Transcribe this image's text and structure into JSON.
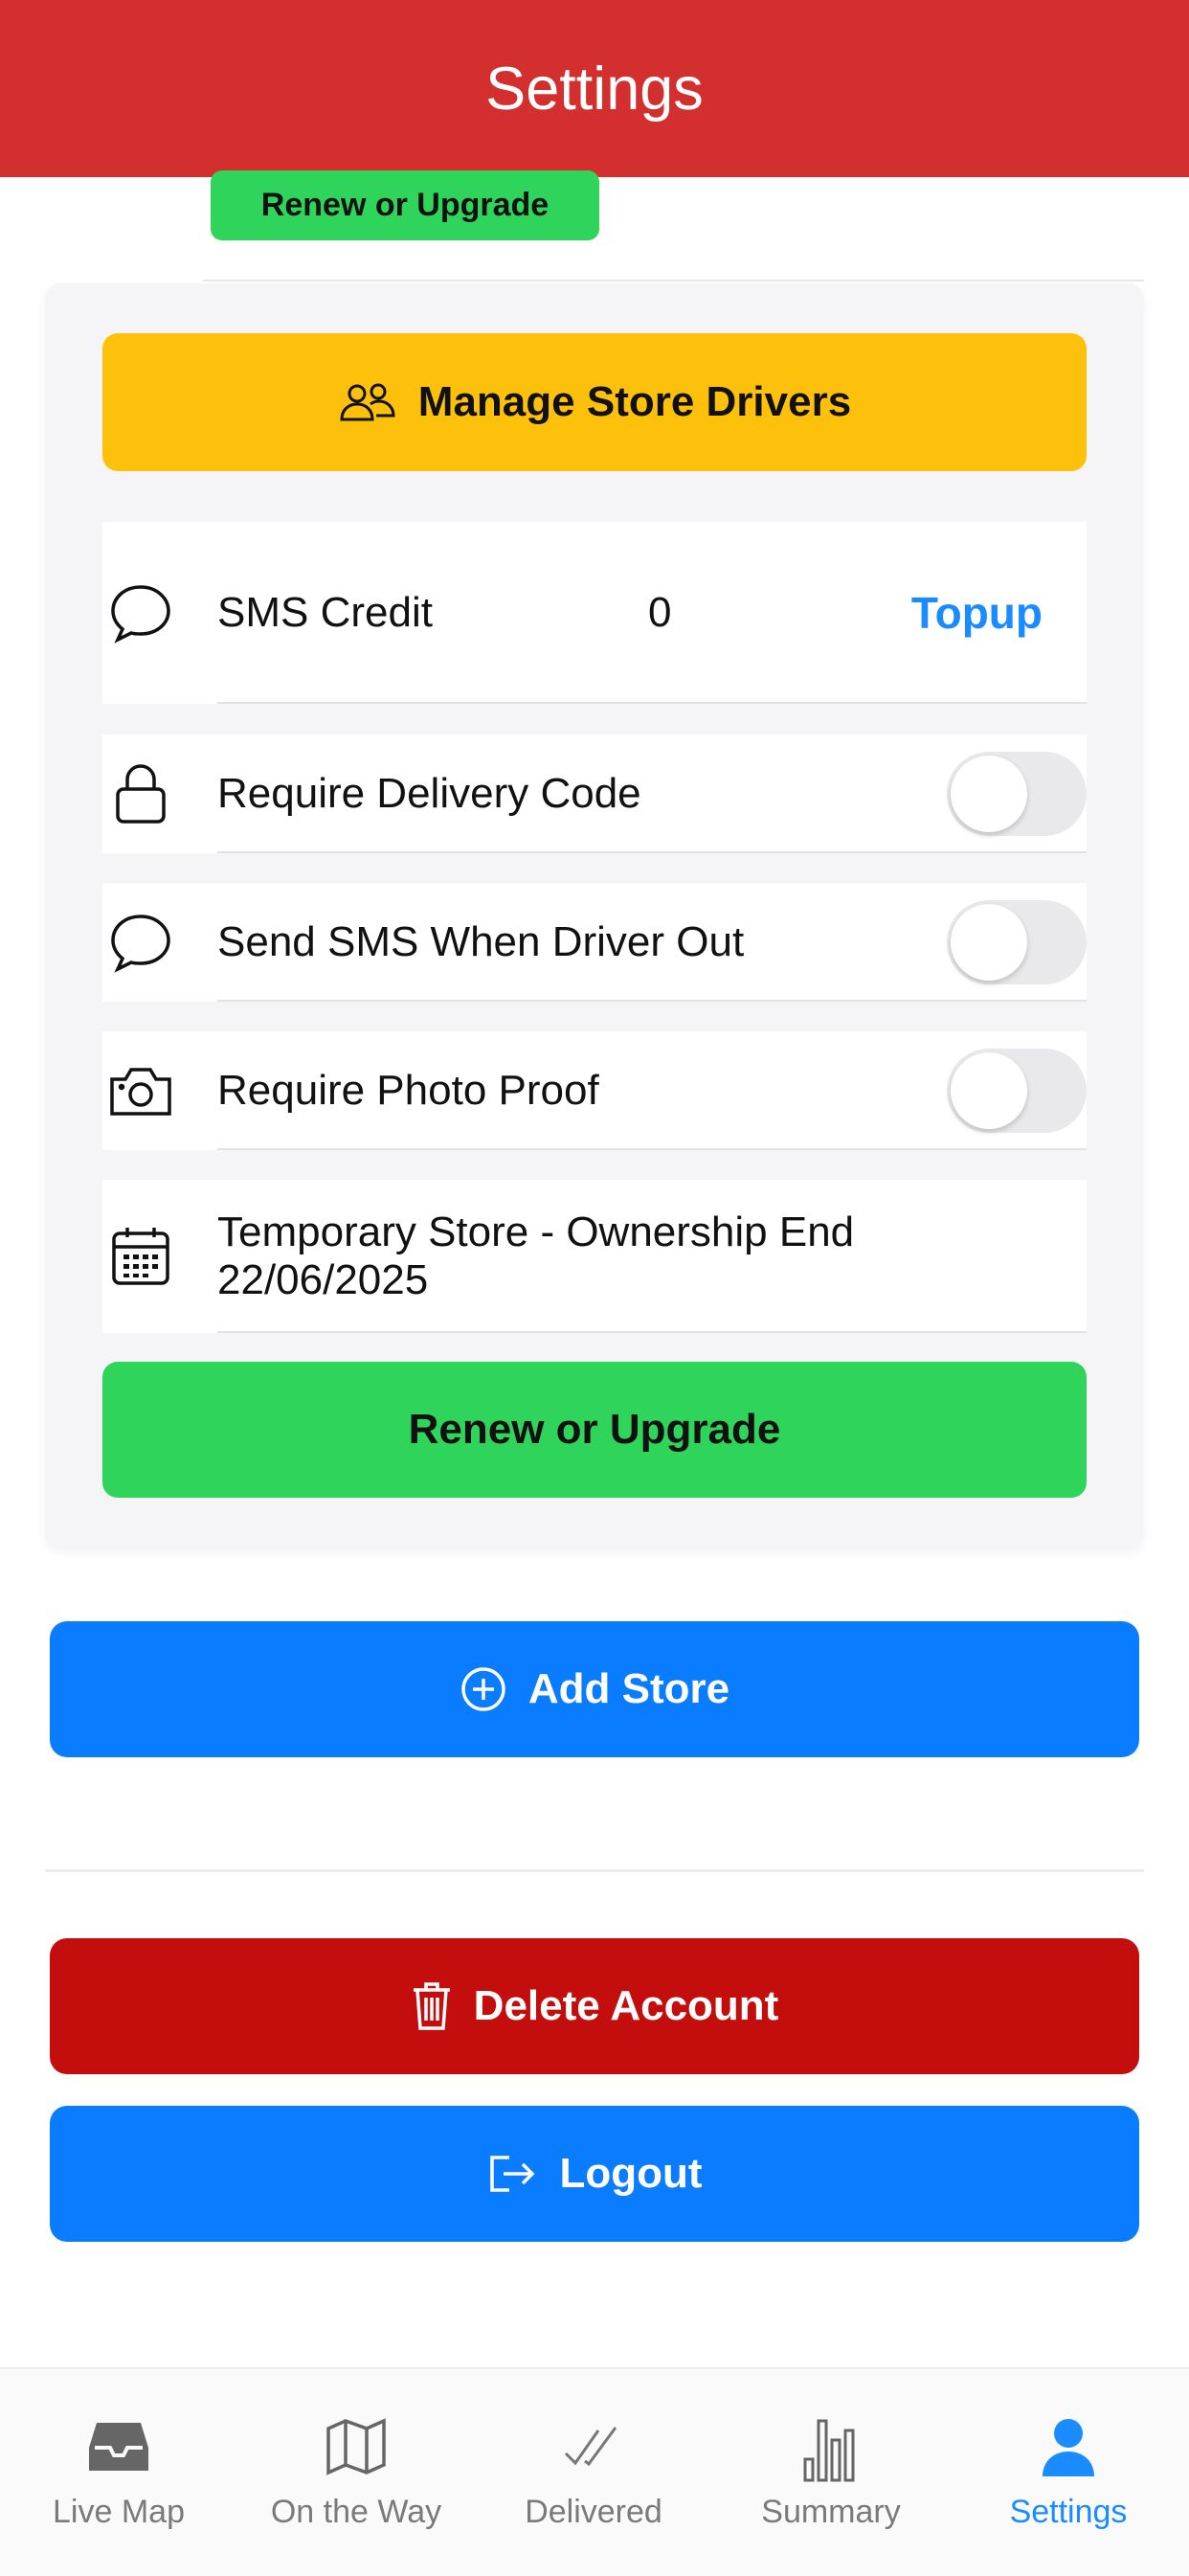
{
  "header": {
    "title": "Settings"
  },
  "store_card": {
    "renew_small_label": "Renew or Upgrade",
    "manage_drivers_label": "Manage Store Drivers",
    "sms_credit": {
      "label": "SMS Credit",
      "value": "0",
      "action": "Topup"
    },
    "toggles": [
      {
        "label": "Require Delivery Code",
        "on": false,
        "icon": "lock-icon"
      },
      {
        "label": "Send SMS When Driver Out",
        "on": false,
        "icon": "chat-bubble-icon"
      },
      {
        "label": "Require Photo Proof",
        "on": false,
        "icon": "camera-icon"
      }
    ],
    "temporary_store": {
      "line1": "Temporary Store - Ownership End",
      "line2": "22/06/2025"
    },
    "renew_label": "Renew or Upgrade"
  },
  "actions": {
    "add_store": "Add Store",
    "delete_account": "Delete Account",
    "logout": "Logout"
  },
  "tabs": [
    {
      "label": "Live Map",
      "icon": "inbox-tray-icon",
      "active": false
    },
    {
      "label": "On the Way",
      "icon": "map-icon",
      "active": false
    },
    {
      "label": "Delivered",
      "icon": "double-check-icon",
      "active": false
    },
    {
      "label": "Summary",
      "icon": "bar-chart-icon",
      "active": false
    },
    {
      "label": "Settings",
      "icon": "person-icon",
      "active": true
    }
  ],
  "colors": {
    "header": "#d32f2f",
    "green": "#2fd55b",
    "yellow": "#fec10b",
    "blue": "#0a7cff",
    "red": "#c40e0e",
    "active_tab": "#1a8cff"
  }
}
